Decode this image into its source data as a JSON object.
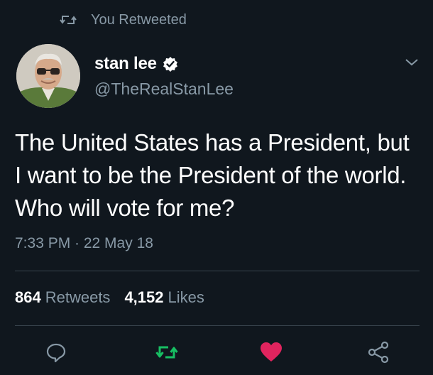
{
  "retweet_context": {
    "label": "You Retweeted",
    "icon": "retweet-icon"
  },
  "author": {
    "display_name": "stan lee",
    "handle": "@TheRealStanLee",
    "verified": true,
    "avatar_icon": "avatar"
  },
  "tweet": {
    "text": "The United States has a President, but I want to be the President of the world. Who will vote for me?",
    "timestamp": "7:33 PM · 22 May 18"
  },
  "stats": {
    "retweets_count": "864",
    "retweets_label": "Retweets",
    "likes_count": "4,152",
    "likes_label": "Likes"
  },
  "actions": [
    {
      "name": "reply",
      "icon": "reply-icon"
    },
    {
      "name": "retweet",
      "icon": "retweet-icon",
      "active": true
    },
    {
      "name": "like",
      "icon": "heart-icon",
      "active": true
    },
    {
      "name": "share",
      "icon": "share-icon"
    }
  ],
  "colors": {
    "background": "#10171e",
    "text_primary": "#ffffff",
    "text_secondary": "#8899a6",
    "divider": "#38444d",
    "retweet_active": "#17bf63",
    "like_active": "#e0245e"
  }
}
